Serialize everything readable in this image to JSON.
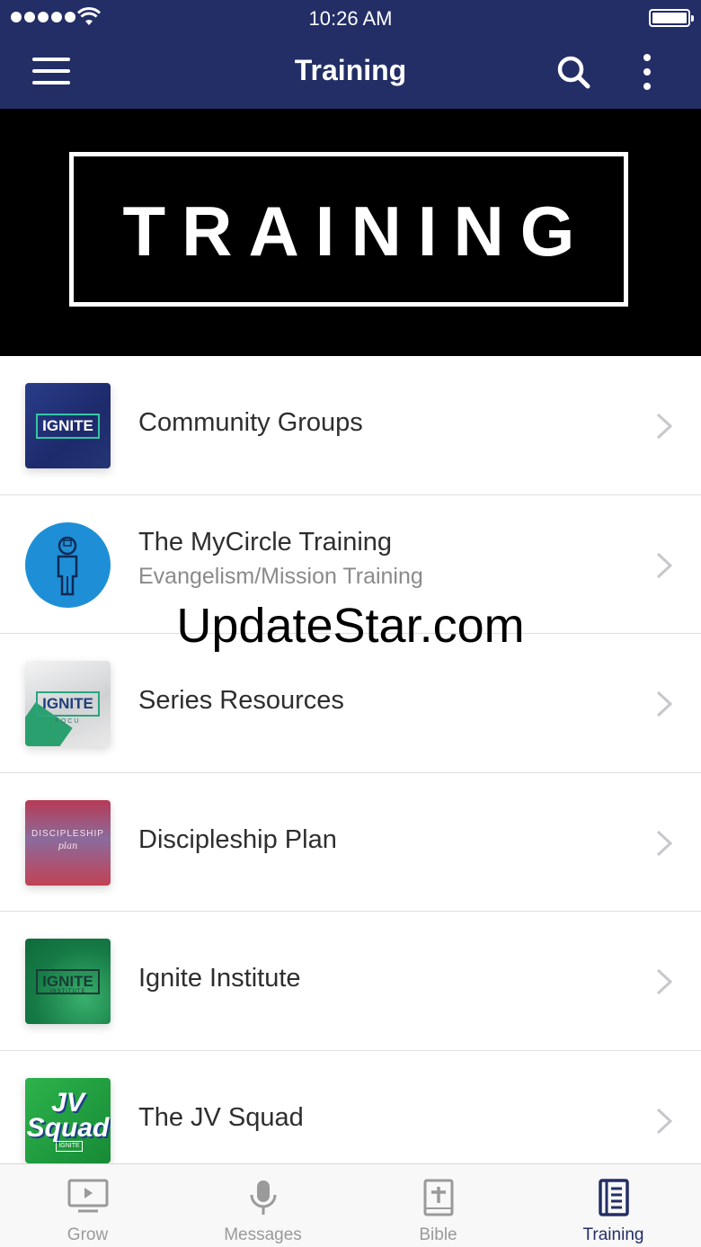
{
  "status_bar": {
    "time": "10:26 AM"
  },
  "nav": {
    "title": "Training"
  },
  "hero": {
    "text": "TRAINING"
  },
  "list": [
    {
      "title": "Community Groups",
      "subtitle": "",
      "thumb_text": "IGNITE"
    },
    {
      "title": "The MyCircle Training",
      "subtitle": "Evangelism/Mission Training"
    },
    {
      "title": "Series Resources",
      "thumb_text": "IGNITE",
      "thumb_subtext": "FOCU"
    },
    {
      "title": "Discipleship Plan",
      "thumb_text": "DISCIPLESHIP",
      "thumb_subtext": "plan"
    },
    {
      "title": "Ignite Institute",
      "thumb_text": "IGNITE",
      "thumb_subtext": "INSTITUTE"
    },
    {
      "title": "The JV Squad",
      "thumb_text": "JV Squad",
      "thumb_subtext": "IGNITE"
    }
  ],
  "watermark": "UpdateStar.com",
  "tabs": [
    {
      "label": "Grow",
      "icon": "tv-play-icon"
    },
    {
      "label": "Messages",
      "icon": "microphone-icon"
    },
    {
      "label": "Bible",
      "icon": "bible-icon"
    },
    {
      "label": "Training",
      "icon": "book-icon",
      "active": true
    }
  ],
  "colors": {
    "nav_bg": "#232e66",
    "active_tab": "#232e66",
    "inactive_tab": "#9a9a9a"
  }
}
